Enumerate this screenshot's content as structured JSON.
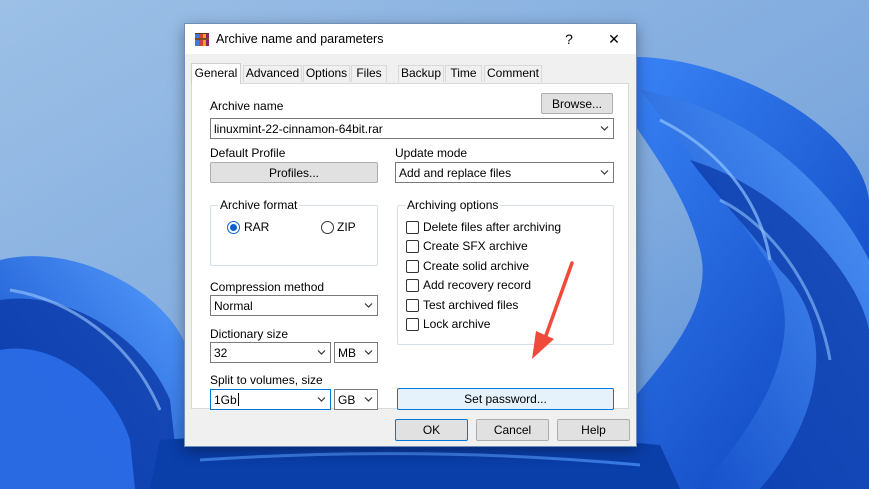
{
  "colors": {
    "accent": "#0078d7",
    "arrow": "#f04a3a",
    "wallpaper": "#1e5dd7"
  },
  "window": {
    "title": "Archive name and parameters",
    "help": "?",
    "close": "✕"
  },
  "tabs": [
    "General",
    "Advanced",
    "Options",
    "Files",
    "Backup",
    "Time",
    "Comment"
  ],
  "general": {
    "archive_name_label": "Archive name",
    "browse_label": "Browse...",
    "archive_name_value": "linuxmint-22-cinnamon-64bit.rar",
    "default_profile_label": "Default Profile",
    "profiles_label": "Profiles...",
    "update_mode_label": "Update mode",
    "update_mode_value": "Add and replace files",
    "archive_format": {
      "title": "Archive format",
      "options": [
        "RAR",
        "ZIP"
      ],
      "selected": "RAR"
    },
    "compression_method_label": "Compression method",
    "compression_method_value": "Normal",
    "dictionary_size_label": "Dictionary size",
    "dictionary_size_value": "32",
    "dictionary_unit": "MB",
    "split_label": "Split to volumes, size",
    "split_value": "1Gb",
    "split_unit": "GB",
    "archiving_options": {
      "title": "Archiving options",
      "items": [
        "Delete files after archiving",
        "Create SFX archive",
        "Create solid archive",
        "Add recovery record",
        "Test archived files",
        "Lock archive"
      ]
    },
    "set_password_label": "Set password..."
  },
  "footer": {
    "ok": "OK",
    "cancel": "Cancel",
    "help": "Help"
  }
}
